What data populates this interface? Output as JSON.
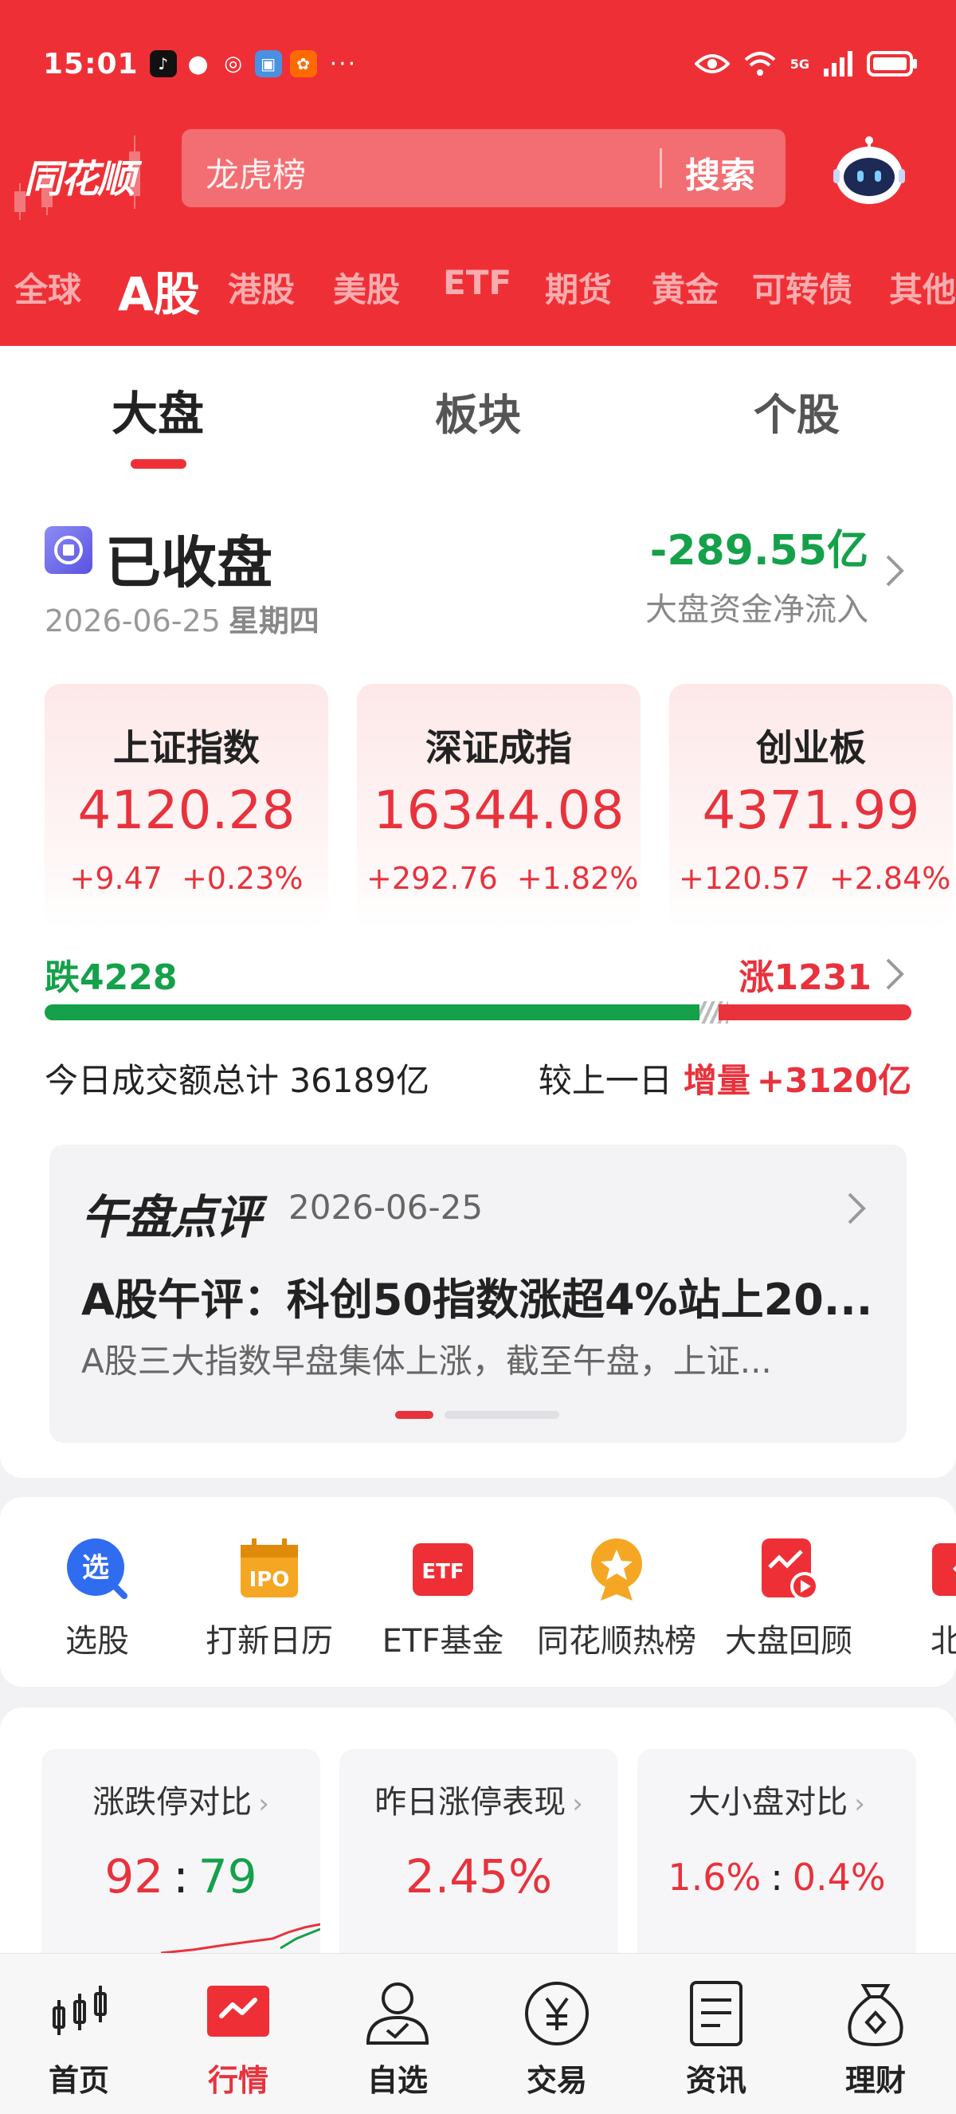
{
  "status_bar": {
    "time": "15:01",
    "network": "5G"
  },
  "header": {
    "logo": "同花顺",
    "search_placeholder": "龙虎榜",
    "search_button": "搜索"
  },
  "market_tabs": [
    "全球",
    "A股",
    "港股",
    "美股",
    "ETF",
    "期货",
    "黄金",
    "可转债",
    "其他"
  ],
  "sub_tabs": [
    "大盘",
    "板块",
    "个股"
  ],
  "market_status": {
    "title": "已收盘",
    "date": "2026-06-25",
    "weekday": "星期四",
    "net_flow_value": "-289.55亿",
    "net_flow_label": "大盘资金净流入"
  },
  "indices": [
    {
      "name": "上证指数",
      "value": "4120.28",
      "change": "+9.47",
      "change_pct": "+0.23%"
    },
    {
      "name": "深证成指",
      "value": "16344.08",
      "change": "+292.76",
      "change_pct": "+1.82%"
    },
    {
      "name": "创业板",
      "value": "4371.99",
      "change": "+120.57",
      "change_pct": "+2.84%"
    }
  ],
  "breadth": {
    "fall_label": "跌4228",
    "rise_label": "涨1231",
    "fall": 4228,
    "rise": 1231
  },
  "turnover": {
    "left_text": "今日成交额总计 36189亿",
    "compare_label": "较上一日",
    "increase_label": "增量",
    "increase_value": "+3120亿"
  },
  "noon_review": {
    "brand": "午盘点评",
    "date": "2026-06-25",
    "headline": "A股午评：科创50指数涨超4%站上20...",
    "summary": "A股三大指数早盘集体上涨，截至午盘，上证..."
  },
  "tools": [
    {
      "label": "选股",
      "icon": "stock-pick-icon"
    },
    {
      "label": "打新日历",
      "icon": "ipo-calendar-icon"
    },
    {
      "label": "ETF基金",
      "icon": "etf-icon"
    },
    {
      "label": "同花顺热榜",
      "icon": "hot-list-icon"
    },
    {
      "label": "大盘回顾",
      "icon": "market-review-icon"
    },
    {
      "label": "北交",
      "icon": "bse-icon"
    }
  ],
  "stats": [
    {
      "title": "涨跌停对比",
      "value_a": "92",
      "value_b": "79"
    },
    {
      "title": "昨日涨停表现",
      "value": "2.45%"
    },
    {
      "title": "大小盘对比",
      "value_a": "1.6%",
      "value_b": "0.4%"
    }
  ],
  "bottom_nav": [
    {
      "label": "首页",
      "icon": "home-candlestick-icon"
    },
    {
      "label": "行情",
      "icon": "market-chart-icon"
    },
    {
      "label": "自选",
      "icon": "watchlist-person-icon"
    },
    {
      "label": "交易",
      "icon": "trade-yen-icon"
    },
    {
      "label": "资讯",
      "icon": "news-document-icon"
    },
    {
      "label": "理财",
      "icon": "wealth-bag-icon"
    }
  ],
  "colors": {
    "brand_red": "#ee3036",
    "up_red": "#e8323c",
    "down_green": "#14a14a"
  }
}
